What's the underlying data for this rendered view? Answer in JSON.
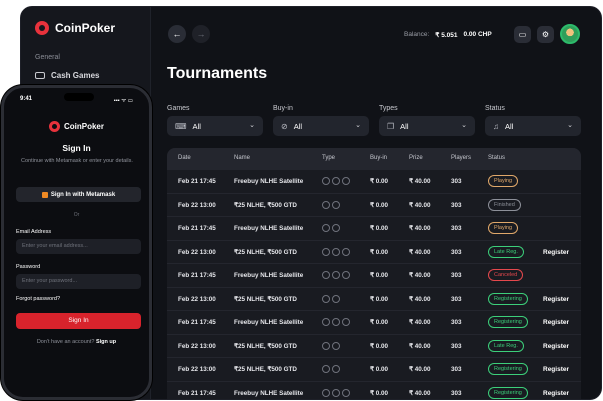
{
  "app": {
    "brand": "CoinPoker"
  },
  "sidebar": {
    "section": "General",
    "item": "Cash Games"
  },
  "topbar": {
    "balance_label": "Balance:",
    "balance_value": "₹ 5.051",
    "chp_value": "0.00 CHP"
  },
  "page": {
    "title": "Tournaments"
  },
  "filters": [
    {
      "label": "Games",
      "value": "All",
      "icon": "gamepad-icon"
    },
    {
      "label": "Buy-in",
      "value": "All",
      "icon": "coin-icon"
    },
    {
      "label": "Types",
      "value": "All",
      "icon": "layers-icon"
    },
    {
      "label": "Status",
      "value": "All",
      "icon": "bell-icon"
    }
  ],
  "table": {
    "headers": [
      "Date",
      "Name",
      "Type",
      "Buy-in",
      "Prize",
      "Players",
      "Status"
    ],
    "rows": [
      {
        "date": "Feb 21 17:45",
        "name": "Freebuy NLHE Satellite",
        "type_icons": 3,
        "buyin": "₹ 0.00",
        "prize": "₹ 40.00",
        "players": "303",
        "status": "Playing",
        "status_color": "#e0a86a",
        "register": ""
      },
      {
        "date": "Feb 22 13:00",
        "name": "₹25 NLHE, ₹500 GTD",
        "type_icons": 2,
        "buyin": "₹ 0.00",
        "prize": "₹ 40.00",
        "players": "303",
        "status": "Finished",
        "status_color": "#8d9099",
        "register": ""
      },
      {
        "date": "Feb 21 17:45",
        "name": "Freebuy NLHE Satellite",
        "type_icons": 2,
        "buyin": "₹ 0.00",
        "prize": "₹ 40.00",
        "players": "303",
        "status": "Playing",
        "status_color": "#e0a86a",
        "register": ""
      },
      {
        "date": "Feb 22 13:00",
        "name": "₹25 NLHE, ₹500 GTD",
        "type_icons": 3,
        "buyin": "₹ 0.00",
        "prize": "₹ 40.00",
        "players": "303",
        "status": "Late Reg.",
        "status_color": "#3ccf7a",
        "register": "Register"
      },
      {
        "date": "Feb 21 17:45",
        "name": "Freebuy NLHE Satellite",
        "type_icons": 3,
        "buyin": "₹ 0.00",
        "prize": "₹ 40.00",
        "players": "303",
        "status": "Canceled",
        "status_color": "#e5484d",
        "register": ""
      },
      {
        "date": "Feb 22 13:00",
        "name": "₹25 NLHE, ₹500 GTD",
        "type_icons": 2,
        "buyin": "₹ 0.00",
        "prize": "₹ 40.00",
        "players": "303",
        "status": "Registering",
        "status_color": "#3ccf7a",
        "register": "Register"
      },
      {
        "date": "Feb 21 17:45",
        "name": "Freebuy NLHE Satellite",
        "type_icons": 3,
        "buyin": "₹ 0.00",
        "prize": "₹ 40.00",
        "players": "303",
        "status": "Registering",
        "status_color": "#3ccf7a",
        "register": "Register"
      },
      {
        "date": "Feb 22 13:00",
        "name": "₹25 NLHE, ₹500 GTD",
        "type_icons": 2,
        "buyin": "₹ 0.00",
        "prize": "₹ 40.00",
        "players": "303",
        "status": "Late Reg.",
        "status_color": "#3ccf7a",
        "register": "Register"
      },
      {
        "date": "Feb 22 13:00",
        "name": "₹25 NLHE, ₹500 GTD",
        "type_icons": 2,
        "buyin": "₹ 0.00",
        "prize": "₹ 40.00",
        "players": "303",
        "status": "Registering",
        "status_color": "#3ccf7a",
        "register": "Register"
      },
      {
        "date": "Feb 21 17:45",
        "name": "Freebuy NLHE Satellite",
        "type_icons": 3,
        "buyin": "₹ 0.00",
        "prize": "₹ 40.00",
        "players": "303",
        "status": "Registering",
        "status_color": "#3ccf7a",
        "register": "Register"
      }
    ]
  },
  "phone": {
    "time": "9:41",
    "signal": "▪▪▪ ᯤ ▭",
    "brand": "CoinPoker",
    "title": "Sign In",
    "subtitle": "Continue with Metamask or enter your details.",
    "metamask_button": "Sign In with Metamask",
    "or_label": "Or",
    "email_label": "Email Address",
    "email_placeholder": "Enter your email address...",
    "password_label": "Password",
    "password_placeholder": "Enter your password...",
    "forgot": "Forgot password?",
    "signin_button": "Sign In",
    "footer_text": "Don't have an account?",
    "footer_link": "Sign up"
  },
  "colors": {
    "accent": "#d8232c",
    "bg": "#101217"
  }
}
